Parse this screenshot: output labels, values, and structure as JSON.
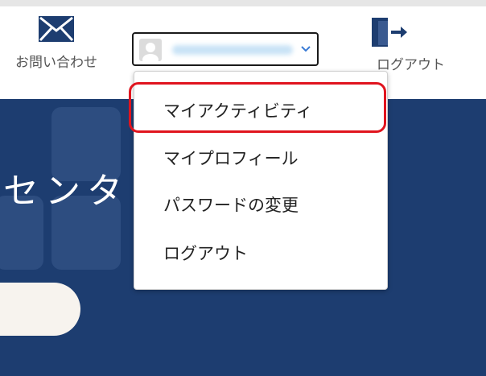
{
  "header": {
    "contact_label": "お問い合わせ",
    "logout_label": "ログアウト",
    "user_name_hidden": true
  },
  "hero": {
    "title": "センタ"
  },
  "dropdown": {
    "items": [
      {
        "label": "マイアクティビティ",
        "highlighted": true
      },
      {
        "label": "マイプロフィール",
        "highlighted": false
      },
      {
        "label": "パスワードの変更",
        "highlighted": false
      },
      {
        "label": "ログアウト",
        "highlighted": false
      }
    ]
  },
  "colors": {
    "hero_bg": "#1d3d70",
    "icon": "#1d3d70",
    "highlight": "#e0141e"
  },
  "icons": {
    "contact": "mail-icon",
    "logout": "door-exit-icon",
    "avatar": "person-icon",
    "caret": "chevron-down-icon"
  }
}
